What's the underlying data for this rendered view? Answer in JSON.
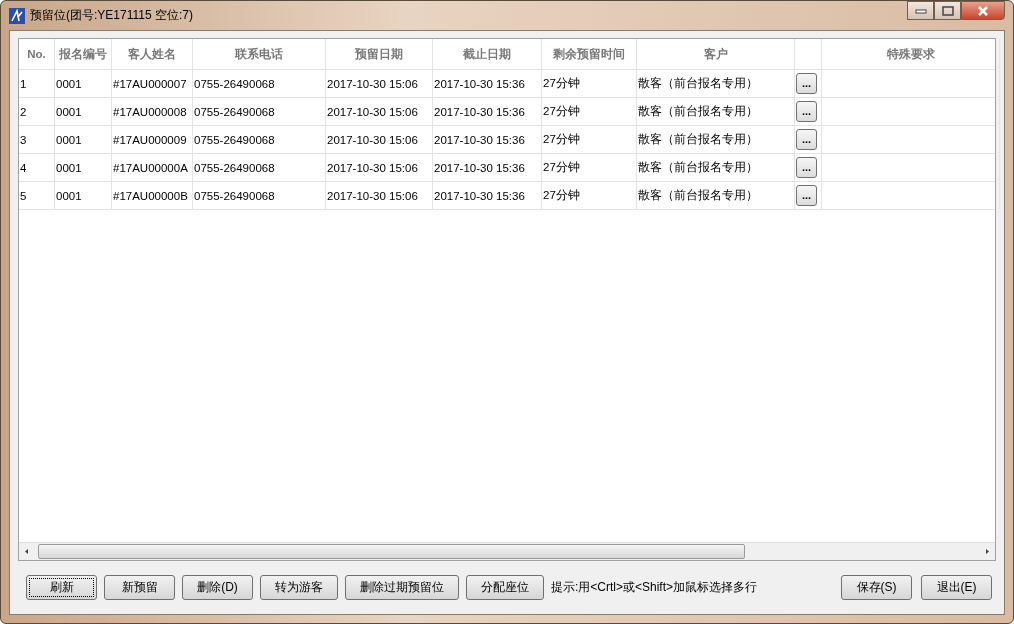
{
  "window": {
    "title": "预留位(团号:YE171115  空位:7)"
  },
  "table": {
    "columns": [
      "No.",
      "报名编号",
      "客人姓名",
      "联系电话",
      "预留日期",
      "截止日期",
      "剩余预留时间",
      "客户",
      "",
      "特殊要求"
    ],
    "rows": [
      {
        "no": "1",
        "code": "0001",
        "name": "#17AU000007",
        "phone": "0755-26490068",
        "reserved": "2017-10-30 15:06",
        "deadline": "2017-10-30 15:36",
        "remaining": "27分钟",
        "customer": "散客（前台报名专用）",
        "more": "...",
        "special": ""
      },
      {
        "no": "2",
        "code": "0001",
        "name": "#17AU000008",
        "phone": "0755-26490068",
        "reserved": "2017-10-30 15:06",
        "deadline": "2017-10-30 15:36",
        "remaining": "27分钟",
        "customer": "散客（前台报名专用）",
        "more": "...",
        "special": ""
      },
      {
        "no": "3",
        "code": "0001",
        "name": "#17AU000009",
        "phone": "0755-26490068",
        "reserved": "2017-10-30 15:06",
        "deadline": "2017-10-30 15:36",
        "remaining": "27分钟",
        "customer": "散客（前台报名专用）",
        "more": "...",
        "special": ""
      },
      {
        "no": "4",
        "code": "0001",
        "name": "#17AU00000A",
        "phone": "0755-26490068",
        "reserved": "2017-10-30 15:06",
        "deadline": "2017-10-30 15:36",
        "remaining": "27分钟",
        "customer": "散客（前台报名专用）",
        "more": "...",
        "special": ""
      },
      {
        "no": "5",
        "code": "0001",
        "name": "#17AU00000B",
        "phone": "0755-26490068",
        "reserved": "2017-10-30 15:06",
        "deadline": "2017-10-30 15:36",
        "remaining": "27分钟",
        "customer": "散客（前台报名专用）",
        "more": "...",
        "special": ""
      }
    ]
  },
  "left_buttons": [
    {
      "label": "刷新",
      "focused": true
    },
    {
      "label": "新预留",
      "focused": false
    },
    {
      "label": "删除(D)",
      "focused": false
    },
    {
      "label": "转为游客",
      "focused": false
    },
    {
      "label": "删除过期预留位",
      "focused": false
    },
    {
      "label": "分配座位",
      "focused": false
    }
  ],
  "hint": "提示:用<Crtl>或<Shift>加鼠标选择多行",
  "right_buttons": [
    {
      "label": "保存(S)",
      "focused": false
    },
    {
      "label": "退出(E)",
      "focused": false
    }
  ]
}
